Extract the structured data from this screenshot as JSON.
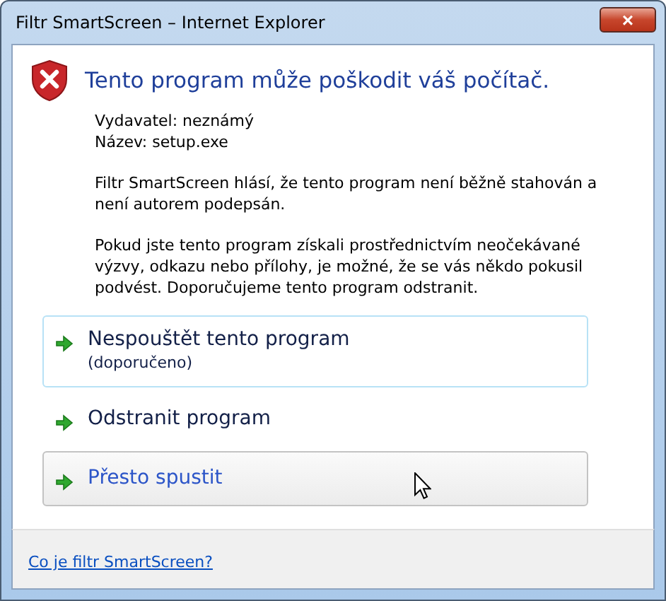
{
  "window": {
    "title": "Filtr SmartScreen – Internet Explorer",
    "close_label": "×"
  },
  "heading": "Tento program může poškodit váš počítač.",
  "details": [
    "Vydavatel: neznámý",
    "Název: setup.exe"
  ],
  "paragraphs": [
    "Filtr SmartScreen hlásí, že tento program není běžně stahován a není autorem podepsán.",
    "Pokud jste tento program získali prostřednictvím neočekávané výzvy, odkazu nebo přílohy, je možné, že se vás někdo pokusil podvést. Doporučujeme tento program odstranit."
  ],
  "options": [
    {
      "label": "Nespouštět tento program",
      "note": "(doporučeno)",
      "focused": true,
      "hovered": false
    },
    {
      "label": "Odstranit program",
      "focused": false,
      "hovered": false
    },
    {
      "label": "Přesto spustit",
      "focused": false,
      "hovered": true
    }
  ],
  "footer_link": "Co je filtr SmartScreen?"
}
